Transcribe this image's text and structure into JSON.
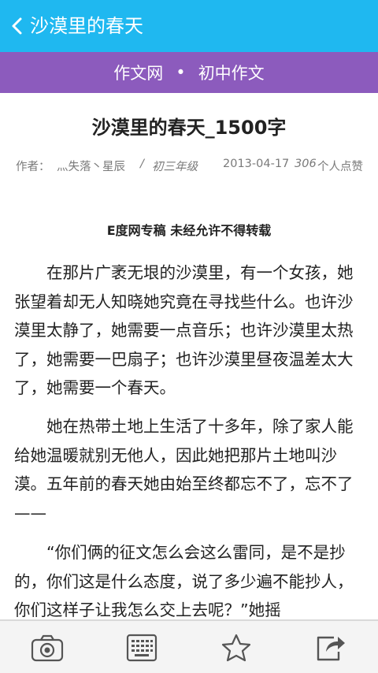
{
  "topbar": {
    "back_icon": "chevron-left-icon",
    "title": "沙漠里的春天"
  },
  "subbar": {
    "site": "作文网",
    "separator": "•",
    "category": "初中作文"
  },
  "article": {
    "title": "沙漠里的春天_1500字",
    "meta": {
      "author_label": "作者：",
      "author": "灬失落丶星辰",
      "separator": "/",
      "grade": "初三年级",
      "date": "2013-04-17",
      "likes_count": "306",
      "likes_suffix": "个人点赞"
    },
    "notice": "E度网专稿 未经允许不得转载",
    "paragraphs": [
      "在那片广袤无垠的沙漠里，有一个女孩，她张望着却无人知晓她究竟在寻找些什么。也许沙漠里太静了，她需要一点音乐；也许沙漠里太热了，她需要一巴扇子；也许沙漠里昼夜温差太大了，她需要一个春天。",
      "她在热带土地上生活了十多年，除了家人能给她温暖就别无他人，因此她把那片土地叫沙漠。五年前的春天她由始至终都忘不了，忘不了——",
      "“你们俩的征文怎么会这么雷同，是不是抄的，你们这是什么态度，说了多少遍不能抄人，你们这样子让我怎么交上去呢？”她摇"
    ]
  },
  "toolbar": {
    "items": [
      "camera-icon",
      "keyboard-icon",
      "star-icon",
      "share-icon"
    ]
  },
  "colors": {
    "topbar": "#1fb8f0",
    "subbar": "#8c5bbd",
    "toolbar": "#f4f4f4"
  }
}
